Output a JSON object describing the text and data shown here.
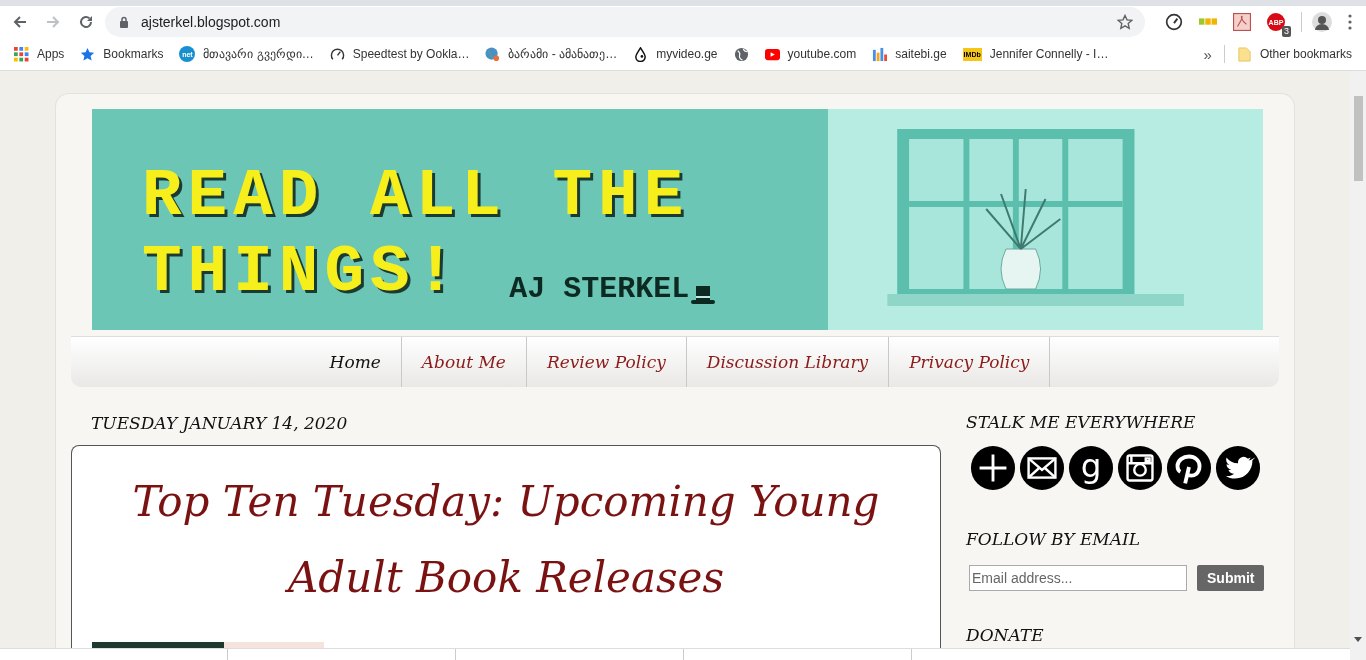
{
  "browser": {
    "url": "ajsterkel.blogspot.com",
    "bookmarks": [
      {
        "label": "Apps",
        "kind": "apps"
      },
      {
        "label": "Bookmarks",
        "kind": "star"
      },
      {
        "label": "მთავარი გვერდი…",
        "kind": "net",
        "icon_text": "net"
      },
      {
        "label": "Speedtest by Ookla…",
        "kind": "gauge"
      },
      {
        "label": "ბარამი - ამანათე…",
        "kind": "globe-pin"
      },
      {
        "label": "myvideo.ge",
        "kind": "drop"
      },
      {
        "kind": "globe"
      },
      {
        "label": "youtube.com",
        "kind": "youtube"
      },
      {
        "label": "saitebi.ge",
        "kind": "bars"
      },
      {
        "label": "Jennifer Connelly - I…",
        "kind": "imdb",
        "icon_text": "IMDb"
      }
    ],
    "overflow": "»",
    "other_bookmarks": "Other bookmarks",
    "extensions": [
      {
        "kind": "gauge"
      },
      {
        "kind": "blocks"
      },
      {
        "kind": "pdf"
      },
      {
        "kind": "stop",
        "text": "ABP",
        "badge": "3"
      },
      {
        "kind": "avatar"
      }
    ]
  },
  "banner": {
    "title_lines": [
      "READ ALL THE",
      "THINGS!"
    ],
    "author": "AJ STERKEL"
  },
  "nav": [
    {
      "label": "Home",
      "selected": true
    },
    {
      "label": "About Me",
      "selected": false
    },
    {
      "label": "Review Policy",
      "selected": false
    },
    {
      "label": "Discussion Library",
      "selected": false
    },
    {
      "label": "Privacy Policy",
      "selected": false
    }
  ],
  "post": {
    "date": "TUESDAY JANUARY 14, 2020",
    "title": "Top Ten Tuesday: Upcoming Young Adult Book Releases"
  },
  "sidebar": {
    "social_heading": "STALK ME EVERYWHERE",
    "social": [
      {
        "kind": "plus"
      },
      {
        "kind": "mail"
      },
      {
        "kind": "goodreads",
        "text": "g"
      },
      {
        "kind": "instagram"
      },
      {
        "kind": "pinterest"
      },
      {
        "kind": "twitter"
      }
    ],
    "follow_heading": "FOLLOW BY EMAIL",
    "email_placeholder": "Email address...",
    "submit": "Submit",
    "donate_heading": "DONATE"
  }
}
